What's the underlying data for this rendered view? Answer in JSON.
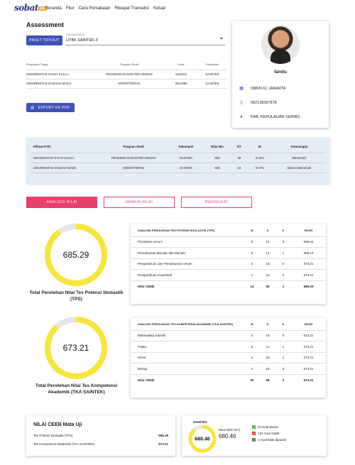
{
  "nav": {
    "logo": "sobat",
    "logo_badge": "ptn",
    "items": [
      "Beranda",
      "Fitur",
      "Cara Pemakaian",
      "Riwayat Transaksi",
      "Keluar"
    ]
  },
  "assessment": {
    "title": "Assessment",
    "paket_button": "PAKET TRYOUT",
    "select_label": "Pilih paket tryout",
    "select_value": "UTBK SAINTEK-3",
    "export_button": "EXPORT KE PDF",
    "headers": [
      "Perguruan Tinggi",
      "Program Studi",
      "Kode",
      "Kelompok"
    ],
    "rows": [
      [
        "UNIVERSITAS SYIAH KUALA",
        "PENDIDIKAN DOKTER HEWAN",
        "1111014",
        "SAINTEK"
      ],
      [
        "UNIVERSITAS GADJAH MADA",
        "KEDOKTERAN",
        "3611066",
        "SAINTEK"
      ]
    ]
  },
  "profile": {
    "name": "fandu",
    "school": "SMKN 61 JAKARTA",
    "phone": "082138267878",
    "location": "KAB. KEPULAUAN SERIBU",
    "icons": [
      "school-icon",
      "phone-icon",
      "location-pin-icon"
    ]
  },
  "ptn_table": {
    "headers": [
      "Pilihan PTN",
      "Program Studi",
      "Kelompok",
      "Nilai Min",
      "DT",
      "IK",
      "Keterangan"
    ],
    "rows": [
      [
        "UNIVERSITAS SYIAH KUALA",
        "PENDIDIKAN DOKTER HEWAN",
        "SAINTEK",
        "503",
        "99",
        "0.12%",
        "Memenuhi"
      ],
      [
        "UNIVERSITAS GADJAH MADA",
        "KEDOKTERAN",
        "SAINTEK",
        "699",
        "63",
        "0.07%",
        "Belum Memenuhi"
      ]
    ]
  },
  "tabs": [
    "ANALISIS NILAI",
    "GRAFIK NILAI",
    "PERINGKAT"
  ],
  "tps": {
    "score": "685.29",
    "fill": 0.9,
    "title": "Total Perolehan Nilai Tes Potensi Skolastik (TPS)",
    "headers": [
      "ANALISIS PEROLEHAN TES POTENSI SKOLASTIK (TPS)",
      "B",
      "S",
      "K",
      "SKOR"
    ],
    "rows": [
      [
        "Penalaran Umum",
        "6",
        "14",
        "0",
        "698.62"
      ],
      [
        "Pemahaman Bacaan dan Menulis",
        "5",
        "14",
        "1",
        "696.13"
      ],
      [
        "Pengetahuan dan Pemahaman Umum",
        "2",
        "18",
        "0",
        "673.21"
      ],
      [
        "Pengetahuan Kuantitatif",
        "1",
        "19",
        "0",
        "673.21"
      ]
    ],
    "total": [
      "Nilai CEEB",
      "14",
      "65",
      "1",
      "685.29"
    ]
  },
  "tka": {
    "score": "673.21",
    "fill": 0.88,
    "title": "Total Perolehan Nilai Tes Kompetensi Akademik (TKA SAINTEK)",
    "headers": [
      "ANALISIS PEROLEHAN TES KOMPETENSI AKADEMIK (TKA SAINTEK)",
      "B",
      "S",
      "K",
      "SKOR"
    ],
    "rows": [
      [
        "Matematika Saintek",
        "4",
        "16",
        "0",
        "673.21"
      ],
      [
        "Fisika",
        "8",
        "11",
        "1",
        "673.21"
      ],
      [
        "Kimia",
        "4",
        "15",
        "1",
        "673.21"
      ],
      [
        "Biologi",
        "4",
        "16",
        "0",
        "673.21"
      ]
    ],
    "total": [
      "Nilai CEEB",
      "20",
      "58",
      "2",
      "673.21"
    ]
  },
  "ceeb": {
    "title": "NILAI CEEB Mata Uji",
    "rows": [
      [
        "Tes Potensi Skolastik (TPS)",
        "685.29"
      ],
      [
        "Tes Kompetensi Akademik (TKA SAINTEK)",
        "673.21"
      ]
    ]
  },
  "saintek": {
    "label": "SAINTEK",
    "score": "680.46",
    "fill": 0.89,
    "final_label": "Nilai Akhir (NA)",
    "final_value": "680.46",
    "legend": [
      {
        "text": "34 Soal Benar",
        "color": "#4caf50",
        "glyph": "✓"
      },
      {
        "text": "123 Soal Salah",
        "color": "#e53935",
        "glyph": "✕"
      },
      {
        "text": "3 Soal tidak dijawab",
        "color": "#757575",
        "glyph": "–"
      }
    ]
  },
  "colors": {
    "gauge": "#f7e53b",
    "gauge_track": "#e6e6e6",
    "primary": "#3f51b5",
    "accent": "#e83e6c"
  }
}
